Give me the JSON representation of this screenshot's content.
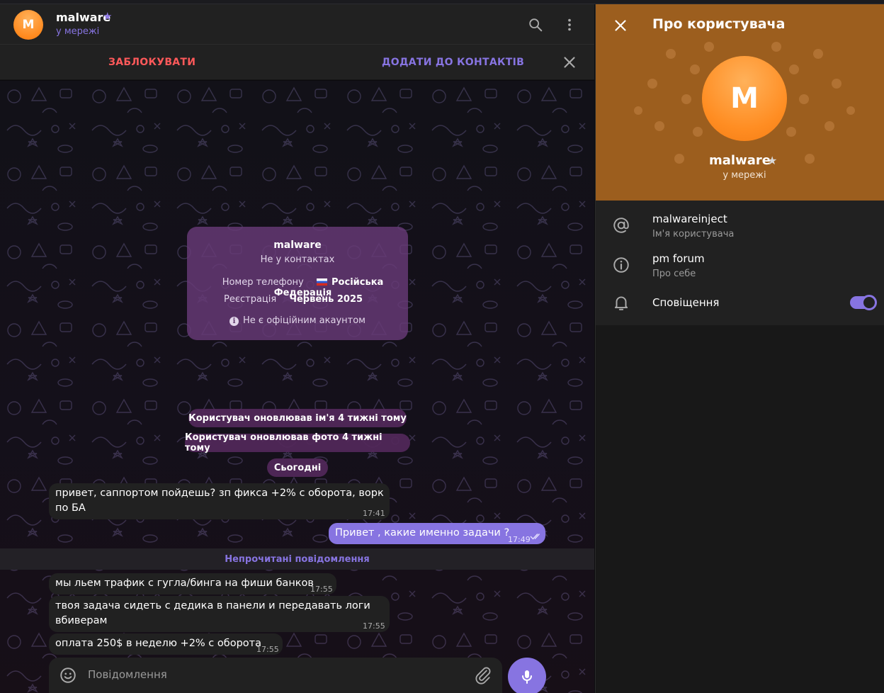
{
  "header": {
    "avatar_letter": "M",
    "name": "malware",
    "star": "★",
    "status": "у мережі"
  },
  "action_bar": {
    "block_label": "ЗАБЛОКУВАТИ",
    "add_label": "ДОДАТИ ДО КОНТАКТІВ"
  },
  "info_card": {
    "name": "malware",
    "subtitle": "Не у контактах",
    "phone_label": "Номер телефону",
    "phone_value": "Російська Федерація",
    "reg_label": "Реєстрація",
    "reg_value": "Червень 2025",
    "note": "Не є офіційним акаунтом"
  },
  "service_messages": [
    "Користувач оновлював ім'я 4 тижні тому",
    "Користувач оновлював фото 4 тижні тому",
    "Сьогодні"
  ],
  "messages": [
    {
      "direction": "in",
      "line1": "привет, саппортом пойдешь? зп фикса +2% с оборота, ворк",
      "line2": "по БА",
      "time": "17:41"
    },
    {
      "direction": "out",
      "text": "Привет , какие именно задачи ?",
      "time": "17:49"
    },
    {
      "direction": "in",
      "text": "мы льем трафик с гугла/бинга на фиши банков",
      "time": "17:55"
    },
    {
      "direction": "in",
      "line1": "твоя задача сидеть с дедика в панели и передавать логи",
      "line2": "вбиверам",
      "time": "17:55"
    },
    {
      "direction": "in",
      "text": "оплата 250$ в неделю +2% с оборота",
      "time": "17:55"
    }
  ],
  "unread_label": "Непрочитані повідомлення",
  "composer": {
    "placeholder": "Повідомлення"
  },
  "sidebar": {
    "title": "Про користувача",
    "avatar_letter": "M",
    "name": "malware",
    "star": "★",
    "status": "у мережі",
    "username": "malwareinject",
    "username_caption": "Ім'я користувача",
    "bio": "pm forum",
    "bio_caption": "Про себе",
    "notifications_label": "Сповіщення",
    "notifications_enabled": true
  },
  "colors": {
    "accent": "#8774e1",
    "danger": "#ff595a",
    "profile_header": "#9c5e1e",
    "avatar": "#ff8a1f"
  }
}
